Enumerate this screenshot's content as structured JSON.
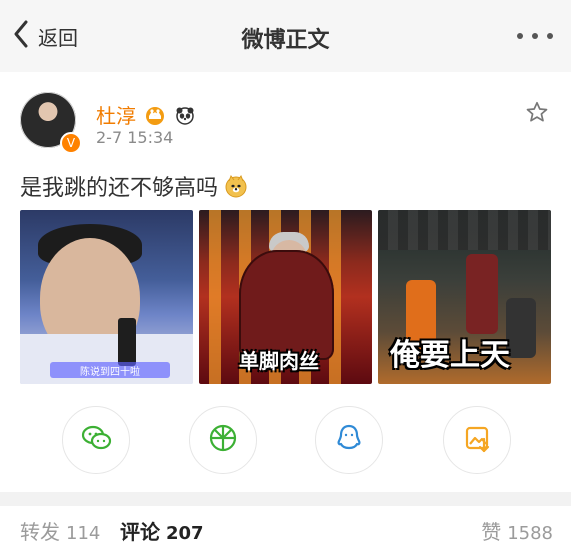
{
  "header": {
    "back_label": "返回",
    "title": "微博正文"
  },
  "post": {
    "user_name": "杜淳",
    "timestamp": "2-7 15:34",
    "text": "是我跳的还不够高吗",
    "verified_label": "V",
    "images": [
      {
        "caption": "陈说到四十啦"
      },
      {
        "caption": "单脚肉丝"
      },
      {
        "caption": "俺要上天"
      }
    ]
  },
  "share": {
    "items": [
      "wechat",
      "moments",
      "qq",
      "save-image"
    ]
  },
  "tabs": [
    {
      "label": "转发",
      "count": "114"
    },
    {
      "label": "评论",
      "count": "207"
    },
    {
      "label": "赞",
      "count": "1588"
    }
  ],
  "colors": {
    "name_orange": "#f17c00",
    "verified_orange": "#ff8200",
    "wechat_green": "#3cb034",
    "qq_blue": "#2f8ad6",
    "save_orange": "#f5a623"
  },
  "icons": {
    "back": "chevron-left-icon",
    "more": "more-dots-icon",
    "star": "star-outline-icon",
    "crown": "crown-icon",
    "panda": "panda-icon",
    "doge": "doge-emoji-icon"
  }
}
